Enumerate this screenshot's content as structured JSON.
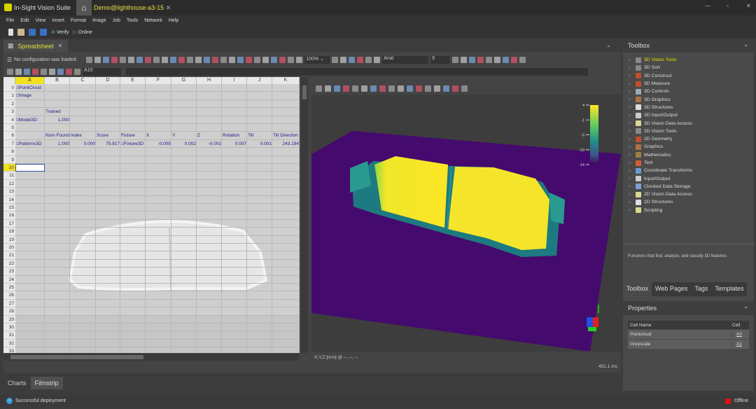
{
  "app": {
    "title": "In-Sight Vision Suite",
    "tab": "Demo@lighthouse-a3-15",
    "accent": "#e6e600"
  },
  "menu": [
    "File",
    "Edit",
    "View",
    "Insert",
    "Format",
    "Image",
    "Job",
    "Tools",
    "Network",
    "Help"
  ],
  "toolbar": {
    "verify": "Verify",
    "online": "Online"
  },
  "spreadsheet": {
    "tab": "Spreadsheet",
    "config_status": "No configuration was loaded.",
    "cell_ref": "A10",
    "zoom": "100%",
    "font": "Arial",
    "font_size": "9",
    "columns": [
      "A",
      "B",
      "C",
      "D",
      "E",
      "F",
      "G",
      "H",
      "I",
      "J",
      "K"
    ],
    "row_count": 34,
    "selected_row": 10,
    "cells": [
      {
        "r": 0,
        "c": 0,
        "v": "□PointCloud"
      },
      {
        "r": 1,
        "c": 0,
        "v": "□Image"
      },
      {
        "r": 3,
        "c": 1,
        "v": "Trained"
      },
      {
        "r": 4,
        "c": 0,
        "v": "□Model3D"
      },
      {
        "r": 4,
        "c": 1,
        "v": "1.000",
        "num": true
      },
      {
        "r": 6,
        "c": 1,
        "v": "Num Found"
      },
      {
        "r": 6,
        "c": 2,
        "v": "Index"
      },
      {
        "r": 6,
        "c": 3,
        "v": "Score"
      },
      {
        "r": 6,
        "c": 4,
        "v": "Fixture"
      },
      {
        "r": 6,
        "c": 5,
        "v": "X"
      },
      {
        "r": 6,
        "c": 6,
        "v": "Y"
      },
      {
        "r": 6,
        "c": 7,
        "v": "Z"
      },
      {
        "r": 6,
        "c": 8,
        "v": "Rotation"
      },
      {
        "r": 6,
        "c": 9,
        "v": "Tilt"
      },
      {
        "r": 6,
        "c": 10,
        "v": "Tilt Direction"
      },
      {
        "r": 7,
        "c": 0,
        "v": "□Patterns3D"
      },
      {
        "r": 7,
        "c": 1,
        "v": "1.000",
        "num": true
      },
      {
        "r": 7,
        "c": 2,
        "v": "0.000",
        "num": true
      },
      {
        "r": 7,
        "c": 3,
        "v": "75.917",
        "num": true
      },
      {
        "r": 7,
        "c": 4,
        "v": "□Fixture3D"
      },
      {
        "r": 7,
        "c": 5,
        "v": "-0.005",
        "num": true
      },
      {
        "r": 7,
        "c": 6,
        "v": "0.002",
        "num": true
      },
      {
        "r": 7,
        "c": 7,
        "v": "-0.001",
        "num": true
      },
      {
        "r": 7,
        "c": 8,
        "v": "0.007",
        "num": true
      },
      {
        "r": 7,
        "c": 9,
        "v": "0.001",
        "num": true
      },
      {
        "r": 7,
        "c": 10,
        "v": "243.194",
        "num": true
      }
    ]
  },
  "view3d": {
    "coords": "X,Y,Z [mm] @ --, --, --",
    "time": "451.1 ms",
    "colorbar_ticks": [
      "4",
      "-1",
      "-5",
      "-10",
      "-14"
    ]
  },
  "bottom_tabs": [
    "Charts",
    "Filmstrip"
  ],
  "toolbox": {
    "title": "Toolbox",
    "items": [
      {
        "label": "3D Vision Tools",
        "color": "#888",
        "active": true
      },
      {
        "label": "3D Sort",
        "color": "#888"
      },
      {
        "label": "3D Construct",
        "color": "#c0502a"
      },
      {
        "label": "3D Measure",
        "color": "#c0502a"
      },
      {
        "label": "3D Controls",
        "color": "#9ab"
      },
      {
        "label": "3D Graphics",
        "color": "#b07040"
      },
      {
        "label": "3D Structures",
        "color": "#ddd"
      },
      {
        "label": "3D Input/Output",
        "color": "#ccc"
      },
      {
        "label": "3D Vision Data Access",
        "color": "#d8d890"
      },
      {
        "label": "2D Vision Tools",
        "color": "#888"
      },
      {
        "label": "2D Geometry",
        "color": "#c0502a"
      },
      {
        "label": "Graphics",
        "color": "#b07040"
      },
      {
        "label": "Mathematics",
        "color": "#a08040"
      },
      {
        "label": "Text",
        "color": "#d06030"
      },
      {
        "label": "Coordinate Transforms",
        "color": "#6a9ad0"
      },
      {
        "label": "Input/Output",
        "color": "#ccc"
      },
      {
        "label": "Clocked Data Storage",
        "color": "#7aa0d0"
      },
      {
        "label": "2D Vision Data Access",
        "color": "#d8d890"
      },
      {
        "label": "2D Structures",
        "color": "#ddd"
      },
      {
        "label": "Scripting",
        "color": "#d8d890"
      }
    ],
    "description": "Functions that find, analyze, and classify 3D features.",
    "tabs": [
      "Toolbox",
      "Web Pages",
      "Tags",
      "Templates"
    ]
  },
  "properties": {
    "title": "Properties",
    "headers": [
      "Cell Name",
      "Cell"
    ],
    "rows": [
      [
        "Pointcloud",
        "A0"
      ],
      [
        "Greyscale",
        "A1"
      ]
    ]
  },
  "status": {
    "message": "Successful deployment",
    "connection": "Offline",
    "offline_color": "#e01010"
  }
}
